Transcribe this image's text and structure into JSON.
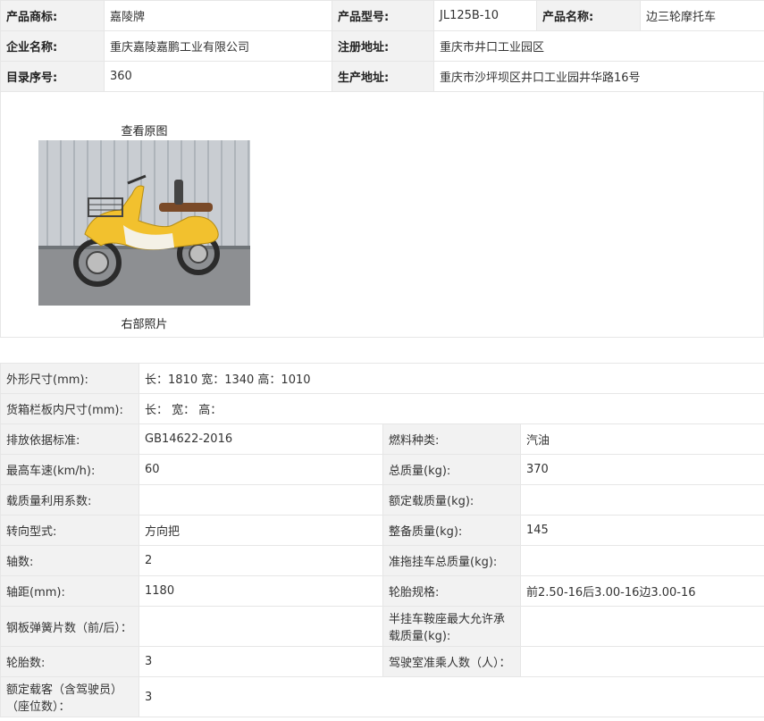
{
  "basic": {
    "brand_label": "产品商标:",
    "brand_value": "嘉陵牌",
    "model_label": "产品型号:",
    "model_value": "JL125B-10",
    "name_label": "产品名称:",
    "name_value": "边三轮摩托车",
    "company_label": "企业名称:",
    "company_value": "重庆嘉陵嘉鹏工业有限公司",
    "reg_addr_label": "注册地址:",
    "reg_addr_value": "重庆市井口工业园区",
    "catalog_label": "目录序号:",
    "catalog_value": "360",
    "prod_addr_label": "生产地址:",
    "prod_addr_value": "重庆市沙坪坝区井口工业园井华路16号"
  },
  "photo": {
    "view_original": "查看原图",
    "caption": "右部照片"
  },
  "specs": {
    "dims_label": "外形尺寸(mm):",
    "dims_value": "长：1810 宽：1340 高：1010",
    "cargo_label": "货箱栏板内尺寸(mm):",
    "cargo_value": "长：  宽：  高：",
    "emission_label": "排放依据标准:",
    "emission_value": "GB14622-2016",
    "fuel_label": "燃料种类:",
    "fuel_value": "汽油",
    "speed_label": "最高车速(km/h):",
    "speed_value": "60",
    "total_mass_label": "总质量(kg):",
    "total_mass_value": "370",
    "util_label": "载质量利用系数:",
    "util_value": "",
    "rated_load_label": "额定载质量(kg):",
    "rated_load_value": "",
    "steer_label": "转向型式:",
    "steer_value": "方向把",
    "curb_label": "整备质量(kg):",
    "curb_value": "145",
    "axles_label": "轴数:",
    "axles_value": "2",
    "trailer_label": "准拖挂车总质量(kg):",
    "trailer_value": "",
    "wheelbase_label": "轴距(mm):",
    "wheelbase_value": "1180",
    "tire_label": "轮胎规格:",
    "tire_value": "前2.50-16后3.00-16边3.00-16",
    "spring_label": "钢板弹簧片数（前/后）：",
    "spring_value": "",
    "saddle_label": "半挂车鞍座最大允许承载质量(kg):",
    "saddle_value": "",
    "tires_label": "轮胎数:",
    "tires_value": "3",
    "cab_label": "驾驶室准乘人数（人）：",
    "cab_value": "",
    "pass_label": "额定载客（含驾驶员）（座位数）：",
    "pass_value": "3"
  }
}
